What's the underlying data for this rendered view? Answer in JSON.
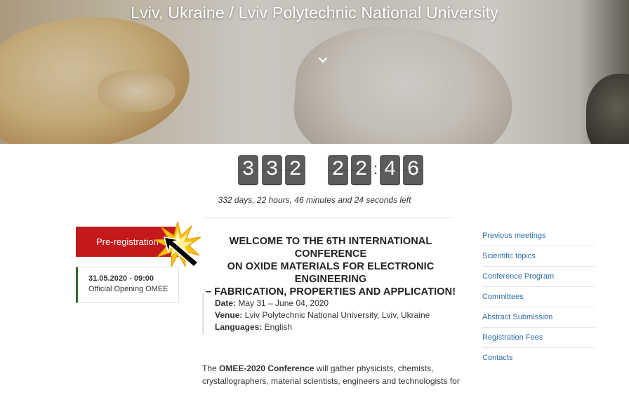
{
  "hero": {
    "title": "Lviv, Ukraine / Lviv Polytechnic National University",
    "scroll_icon": "chevron-down-icon"
  },
  "countdown": {
    "digits": [
      "3",
      "3",
      "2",
      "2",
      "2",
      "4",
      "6"
    ],
    "separator": ":",
    "text": "332 days, 22 hours, 46 minutes and 24 seconds left"
  },
  "left": {
    "prereg_label": "Pre-registration",
    "event_date": "31.05.2020 - 09:00",
    "event_name": "Official Opening OMEE"
  },
  "main": {
    "welcome_line1": "WELCOME TO THE 6TH INTERNATIONAL CONFERENCE",
    "welcome_line2": "ON OXIDE MATERIALS FOR ELECTRONIC ENGINEERING",
    "welcome_line3": "– FABRICATION, PROPERTIES AND APPLICATION!",
    "date_label": "Date:",
    "date_value": " May 31 – June 04, 2020",
    "venue_label": "Venue:",
    "venue_value": " Lviv Polytechnic National University, Lviv, Ukraine",
    "languages_label": "Languages:",
    "languages_value": " English",
    "para_prefix": "The ",
    "para_bold": "OMEE-2020 Conference",
    "para_line1_rest": " will gather physicists, chemists,",
    "para_line2": "crystallographers, material scientists, engineers and technologists for"
  },
  "sidebar": {
    "items": [
      "Previous meetings",
      "Scientific topics",
      "Conference Program",
      "Committees",
      "Abstract Submission",
      "Registration Fees",
      "Contacts"
    ]
  },
  "colors": {
    "accent_red": "#c4191c",
    "link_blue": "#2f6fa8",
    "event_border_green": "#2e6b2e",
    "digit_bg": "#5c5c5c"
  }
}
